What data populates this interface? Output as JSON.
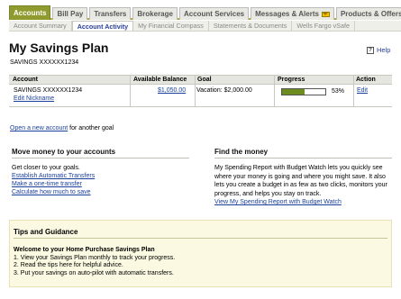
{
  "nav": {
    "primary_tabs": [
      "Accounts",
      "Bill Pay",
      "Transfers",
      "Brokerage",
      "Account Services",
      "Messages & Alerts",
      "Products & Offers"
    ],
    "secondary_tabs": [
      "Account Summary",
      "Account Activity",
      "My Financial Compass",
      "Statements & Documents",
      "Wells Fargo vSafe"
    ]
  },
  "page": {
    "title": "My Savings Plan",
    "account_number": "SAVINGS XXXXXX1234",
    "help_label": "Help"
  },
  "table": {
    "headers": [
      "Account",
      "Available Balance",
      "Goal",
      "Progress",
      "Action"
    ],
    "row": {
      "account": "SAVINGS XXXXXX1234",
      "edit_nickname": "Edit Nickname",
      "balance": "$1,050.00",
      "goal": "Vacation: $2,000.00",
      "progress_percent": 53,
      "progress_label": "53%",
      "action": "Edit"
    }
  },
  "new_account": {
    "link": "Open a new account",
    "suffix": "for another goal"
  },
  "move_money": {
    "heading": "Move money to your accounts",
    "intro": "Get closer to your goals.",
    "links": [
      "Establish Automatic Transfers",
      "Make a one-time transfer",
      "Calculate how much to save"
    ]
  },
  "find_money": {
    "heading": "Find the money",
    "body": "My Spending Report with Budget Watch lets you quickly see where your money is going and where you might save. It also lets you create a budget in as few as two clicks, monitors your progress, and helps you stay on track.",
    "link": "View My Spending Report with Budget Watch"
  },
  "tips": {
    "heading": "Tips and Guidance",
    "subheading": "Welcome to your Home Purchase Savings Plan",
    "items": [
      "1. View your Savings Plan monthly to track your progress.",
      "2. Read the tips here for helpful advice.",
      "3. Put your savings on auto-pilot with automatic transfers."
    ]
  },
  "colors": {
    "accent": "#8f9b2e",
    "link": "#1a3f9c",
    "progress": "#6c8c1e",
    "tips_bg": "#fbf9e1"
  }
}
